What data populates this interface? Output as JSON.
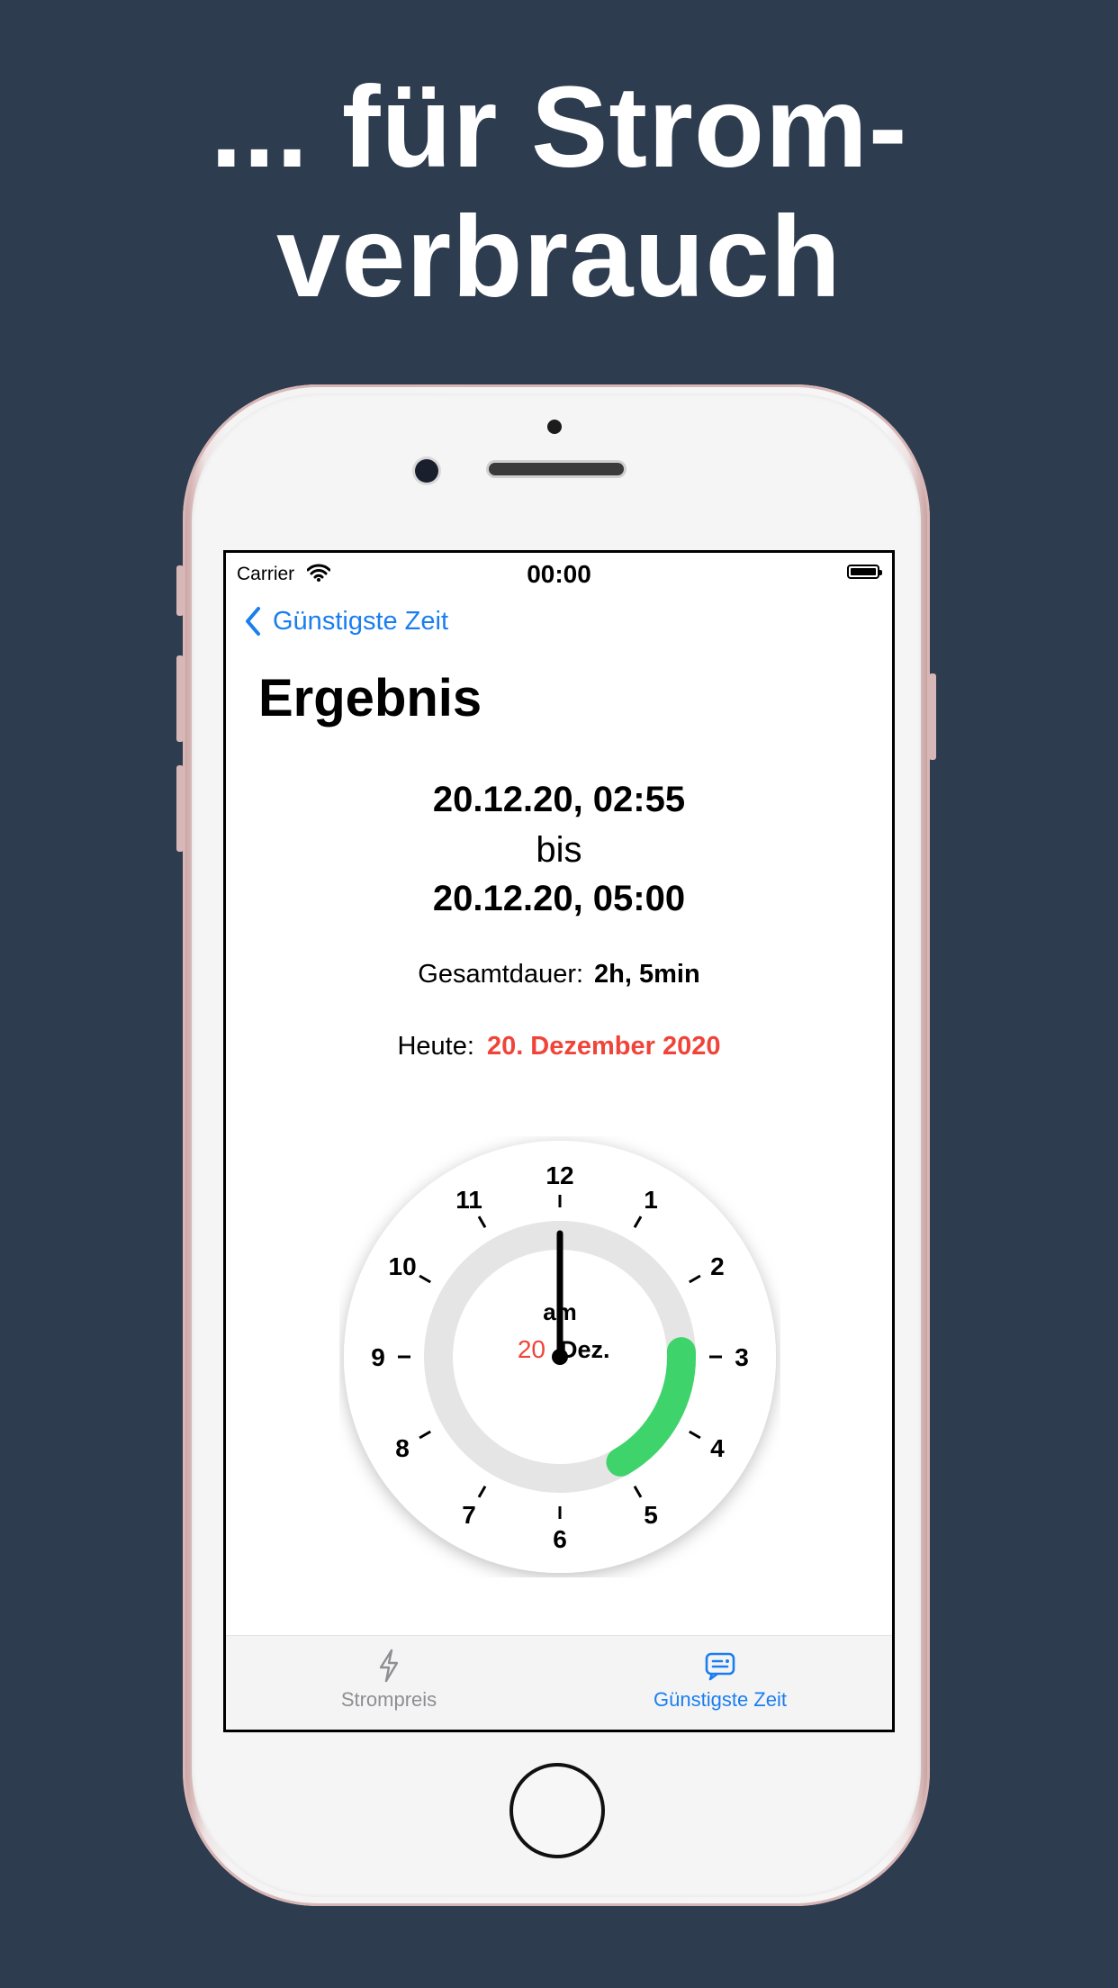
{
  "headline": {
    "line1": "... für Strom-",
    "line2": "verbrauch"
  },
  "status_bar": {
    "carrier": "Carrier",
    "time": "00:00"
  },
  "nav": {
    "back_label": "Günstigste Zeit"
  },
  "page": {
    "title": "Ergebnis"
  },
  "result": {
    "start": "20.12.20, 02:55",
    "separator": "bis",
    "end": "20.12.20, 05:00",
    "duration_label": "Gesamtdauer:",
    "duration_value": "2h, 5min",
    "today_label": "Heute:",
    "today_value": "20. Dezember 2020"
  },
  "clock": {
    "numbers": [
      "12",
      "1",
      "2",
      "3",
      "4",
      "5",
      "6",
      "7",
      "8",
      "9",
      "10",
      "11"
    ],
    "center_line1": "am",
    "center_day": "20",
    "center_month": "Dez.",
    "arc_start_hour": 2.9167,
    "arc_end_hour": 5.0,
    "hand_hour": 12,
    "arc_color": "#3fd46b",
    "ring_color": "#e5e5e5",
    "day_color": "#f0443a"
  },
  "tab_bar": {
    "tabs": [
      {
        "label": "Strompreis",
        "icon": "bolt-icon",
        "active": false
      },
      {
        "label": "Günstigste Zeit",
        "icon": "chat-list-icon",
        "active": true
      }
    ]
  },
  "colors": {
    "accent": "#1a7ef0",
    "highlight_red": "#f0443a",
    "background": "#2e3c4f"
  }
}
